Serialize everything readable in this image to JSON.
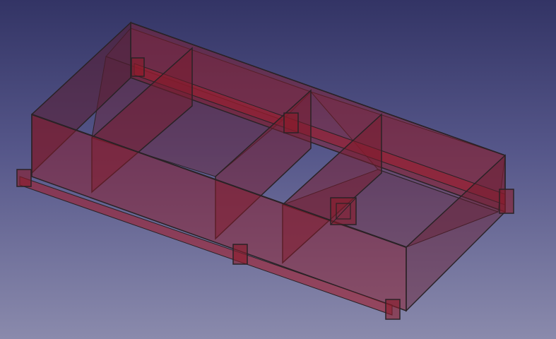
{
  "viewer": {
    "background_top": "#333465",
    "background_bottom": "#8a8aac"
  },
  "model": {
    "face_color": "#8b1a2a",
    "face_opacity": 0.55,
    "edge_color": "#2a2226",
    "components": [
      "back-wall",
      "side-wall-left",
      "side-wall-right",
      "front-wall",
      "divider-walls",
      "rails",
      "brackets",
      "center-fixture"
    ]
  }
}
